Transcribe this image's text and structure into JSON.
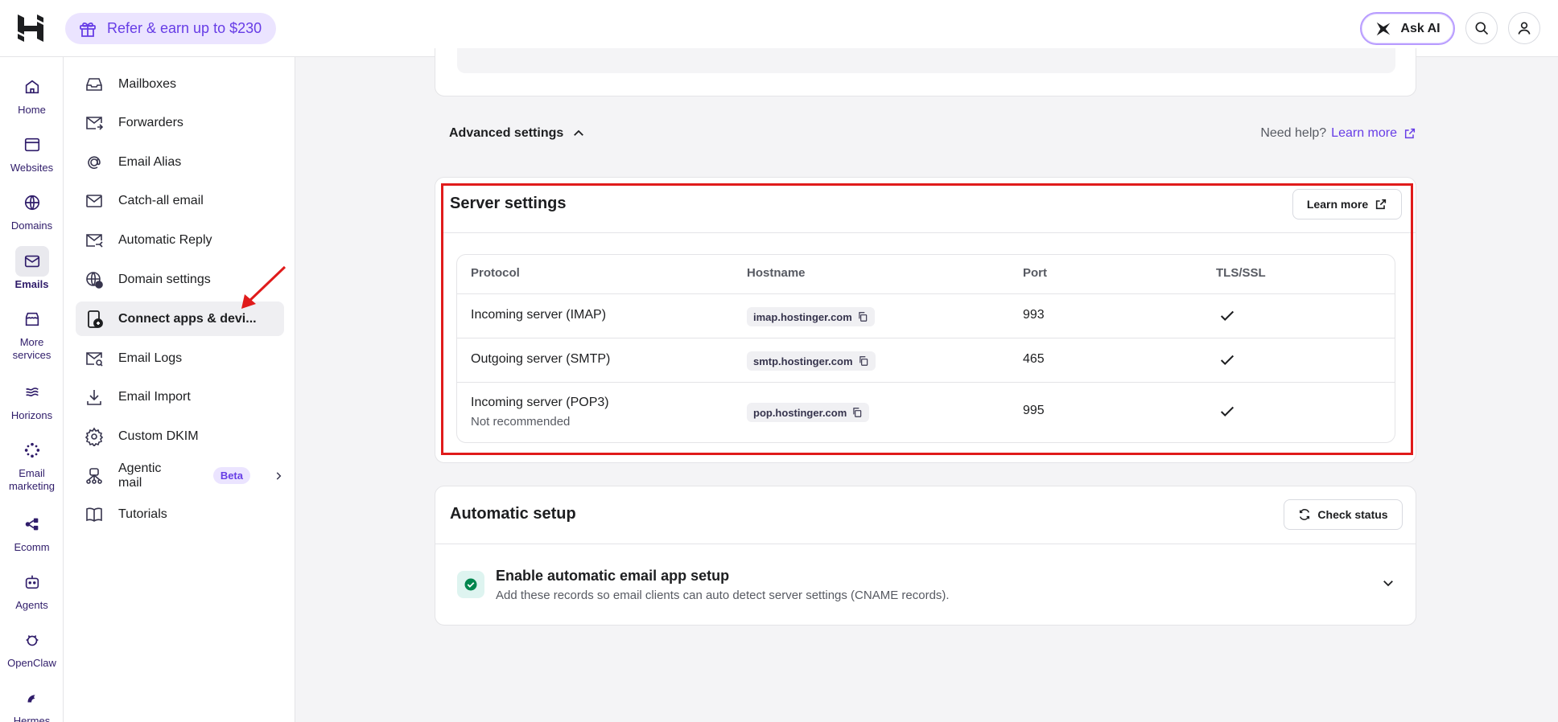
{
  "topbar": {
    "promo_label": "Refer & earn up to $230",
    "ask_ai_label": "Ask AI"
  },
  "rail": {
    "items": [
      {
        "label": "Home",
        "icon": "home-icon"
      },
      {
        "label": "Websites",
        "icon": "browser-window-icon"
      },
      {
        "label": "Domains",
        "icon": "globe-icon"
      },
      {
        "label": "Emails",
        "icon": "mail-icon",
        "active": true
      },
      {
        "label": "More services",
        "icon": "store-icon"
      },
      {
        "label": "Horizons",
        "icon": "horizons-icon"
      },
      {
        "label": "Email marketing",
        "icon": "email-marketing-icon"
      },
      {
        "label": "Ecomm",
        "icon": "ecommerce-icon"
      },
      {
        "label": "Agents",
        "icon": "robot-icon"
      },
      {
        "label": "OpenClaw",
        "icon": "claw-icon"
      },
      {
        "label": "Hermes",
        "icon": "hermes-icon"
      }
    ]
  },
  "sidebar": {
    "items": [
      {
        "label": "Mailboxes",
        "icon": "inbox-icon"
      },
      {
        "label": "Forwarders",
        "icon": "mail-forward-icon"
      },
      {
        "label": "Email Alias",
        "icon": "at-sign-icon"
      },
      {
        "label": "Catch-all email",
        "icon": "envelope-icon"
      },
      {
        "label": "Automatic Reply",
        "icon": "mail-reply-icon"
      },
      {
        "label": "Domain settings",
        "icon": "globe-settings-icon"
      },
      {
        "label": "Connect apps & devi...",
        "icon": "device-add-icon",
        "active": true
      },
      {
        "label": "Email Logs",
        "icon": "mail-search-icon"
      },
      {
        "label": "Email Import",
        "icon": "download-icon"
      },
      {
        "label": "Custom DKIM",
        "icon": "gear-icon"
      },
      {
        "label": "Agentic mail",
        "icon": "agent-mail-icon",
        "badge": "Beta"
      },
      {
        "label": "Tutorials",
        "icon": "book-icon"
      }
    ]
  },
  "advanced": {
    "label": "Advanced settings",
    "help_text": "Need help?",
    "help_link": "Learn more"
  },
  "server_settings": {
    "title": "Server settings",
    "learn_more": "Learn more",
    "columns": [
      "Protocol",
      "Hostname",
      "Port",
      "TLS/SSL"
    ],
    "rows": [
      {
        "protocol": "Incoming server (IMAP)",
        "note": "",
        "hostname": "imap.hostinger.com",
        "port": "993",
        "tls": true
      },
      {
        "protocol": "Outgoing server (SMTP)",
        "note": "",
        "hostname": "smtp.hostinger.com",
        "port": "465",
        "tls": true
      },
      {
        "protocol": "Incoming server (POP3)",
        "note": "Not recommended",
        "hostname": "pop.hostinger.com",
        "port": "995",
        "tls": true
      }
    ]
  },
  "automatic_setup": {
    "title": "Automatic setup",
    "check_status": "Check status",
    "item_title": "Enable automatic email app setup",
    "item_desc": "Add these records so email clients can auto detect server settings (CNAME records)."
  },
  "colors": {
    "accent": "#673de6",
    "highlight": "#e01b1b",
    "success": "#00b090"
  }
}
